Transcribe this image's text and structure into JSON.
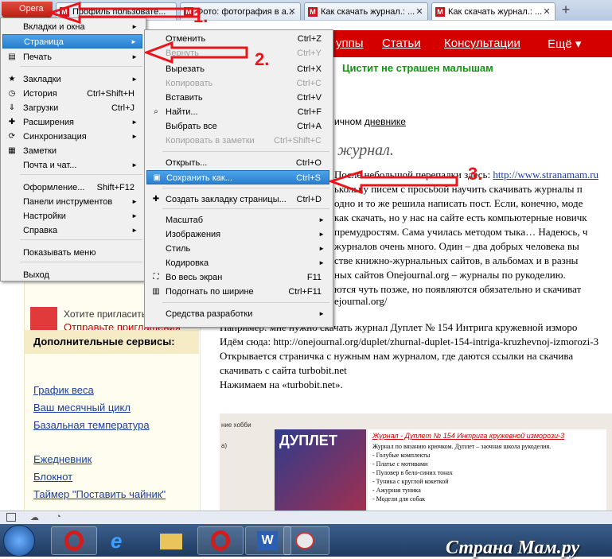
{
  "browser": {
    "opera_button": "Opera",
    "tabs": [
      {
        "label": "Профиль пользовате..."
      },
      {
        "label": "Фото: фотография в а..."
      },
      {
        "label": "Как скачать журнал.: ..."
      },
      {
        "label": "Как скачать журнал.: ..."
      }
    ],
    "newtab_icon": "plus-icon"
  },
  "page": {
    "nav": [
      "уппы",
      "Статьи",
      "Консультации",
      "Ещё ▾"
    ],
    "banner": "Цистит не страшен малышам",
    "diary_prefix": "ичном",
    "diary_link": "дневнике",
    "post_title": "журнал.",
    "lines": [
      {
        "text": "После небольшой перепалки здесь: ",
        "link": "http://www.stranamam.ru"
      },
      {
        "text": "ькольку писем с просьбой научить скачивать журналы п"
      },
      {
        "text": "одно и то же решила написать пост. Если, конечно, моде"
      },
      {
        "text": "как скачать, но у нас на сайте есть компьютерные новичк"
      },
      {
        "text": "премудростям. Сама училась методом тыка… Надеюсь, ч"
      },
      {
        "text": "журналов очень много. Один – два добрых человека вы"
      },
      {
        "text": "стве книжно-журнальных сайтов, в альбомах и в разны"
      },
      {
        "text": "ных сайтов Onejournal.org – журналы по рукоделию."
      },
      {
        "text": "ются чуть позже, но появляются обязательно и скачиват"
      },
      {
        "text": "ejournal.org/"
      },
      {
        "text": ""
      },
      {
        "text": "Например: мне нужно скачать журнал Дуплет № 154 Интрига кружевной изморо"
      },
      {
        "text": "Идём сюда: http://onejournal.org/duplet/zhurnal-duplet-154-intriga-kruzhevnoj-izmorozi-3"
      },
      {
        "text": "Открывается страничка с нужным нам журналом, где даются ссылки на скачива"
      },
      {
        "text": "скачивать с сайта turbobit.net"
      },
      {
        "text": "Нажимаем на «turbobit.net»."
      }
    ],
    "invite_text": "Хотите пригласить",
    "invite_link": "Отправьте приглашения",
    "services_title": "Дополнительные сервисы:",
    "services": [
      "График веса",
      "Ваш месячный цикл",
      "Базальная температура"
    ],
    "services2": [
      "Ежедневник",
      "Блокнот",
      "Таймер \"Поставить чайник\""
    ],
    "magazine_title": "Журнал - Дуплет № 154 Интрига кружевной изморози-3",
    "magazine_lines": [
      "Журнал по вязанию крючком. Дуплет – заочная школа рукоделия.",
      "- Голубые комплекты",
      "- Платье с мотивами",
      "- Пуловер в бело-синих тонах",
      "- Туника с круглой кокеткой",
      "- Ажурная туника",
      "- Модели для собак"
    ],
    "magazine_cover_text": "ДУПЛЕТ",
    "left_snippets": [
      "ние хобби",
      "а)"
    ]
  },
  "main_menu": {
    "items": [
      {
        "label": "Вкладки и окна",
        "arrow": "►"
      },
      {
        "label": "Страница",
        "arrow": "►",
        "highlighted": true
      },
      {
        "label": "Печать",
        "arrow": "►",
        "icon": "printer-icon"
      },
      {
        "label": "Закладки",
        "arrow": "►",
        "icon": "star-icon"
      },
      {
        "label": "История",
        "shortcut": "Ctrl+Shift+H",
        "icon": "history-icon"
      },
      {
        "label": "Загрузки",
        "shortcut": "Ctrl+J",
        "icon": "download-icon"
      },
      {
        "label": "Расширения",
        "arrow": "►",
        "icon": "puzzle-icon"
      },
      {
        "label": "Синхронизация",
        "arrow": "►",
        "icon": "sync-icon"
      },
      {
        "label": "Заметки",
        "icon": "notes-icon"
      },
      {
        "label": "Почта и чат...",
        "arrow": "►"
      },
      {
        "label": "Оформление...",
        "shortcut": "Shift+F12"
      },
      {
        "label": "Панели инструментов",
        "arrow": "►"
      },
      {
        "label": "Настройки",
        "arrow": "►"
      },
      {
        "label": "Справка",
        "arrow": "►"
      },
      {
        "label": "Показывать меню"
      },
      {
        "label": "Выход"
      }
    ]
  },
  "sub_menu": {
    "items": [
      {
        "label": "Отменить",
        "shortcut": "Ctrl+Z"
      },
      {
        "label": "Вернуть",
        "shortcut": "Ctrl+Y",
        "disabled": true
      },
      {
        "label": "Вырезать",
        "shortcut": "Ctrl+X"
      },
      {
        "label": "Копировать",
        "shortcut": "Ctrl+C",
        "disabled": true
      },
      {
        "label": "Вставить",
        "shortcut": "Ctrl+V"
      },
      {
        "label": "Найти...",
        "shortcut": "Ctrl+F",
        "icon": "search-icon"
      },
      {
        "label": "Выбрать все",
        "shortcut": "Ctrl+A"
      },
      {
        "label": "Копировать в заметки",
        "shortcut": "Ctrl+Shift+C",
        "disabled": true
      },
      {
        "label": "Открыть...",
        "shortcut": "Ctrl+O"
      },
      {
        "label": "Сохранить как...",
        "shortcut": "Ctrl+S",
        "highlighted": true,
        "icon": "save-icon"
      },
      {
        "label": "Создать закладку страницы...",
        "shortcut": "Ctrl+D",
        "icon": "plus-icon"
      },
      {
        "label": "Масштаб",
        "arrow": "►"
      },
      {
        "label": "Изображения",
        "arrow": "►"
      },
      {
        "label": "Стиль",
        "arrow": "►"
      },
      {
        "label": "Кодировка",
        "arrow": "►"
      },
      {
        "label": "Во весь экран",
        "shortcut": "F11",
        "icon": "fullscreen-icon"
      },
      {
        "label": "Подогнать по ширине",
        "shortcut": "Ctrl+F11",
        "icon": "fit-width-icon"
      },
      {
        "label": "Средства разработки",
        "arrow": "►"
      }
    ]
  },
  "annotations": {
    "step1": "1.",
    "step2": "2.",
    "step3": "3."
  },
  "watermark": "Страна Мам.ру",
  "colors": {
    "highlight": "#2a7fd0",
    "arrow": "#e8161c",
    "nav": "#d40000",
    "banner_green": "#109510"
  }
}
